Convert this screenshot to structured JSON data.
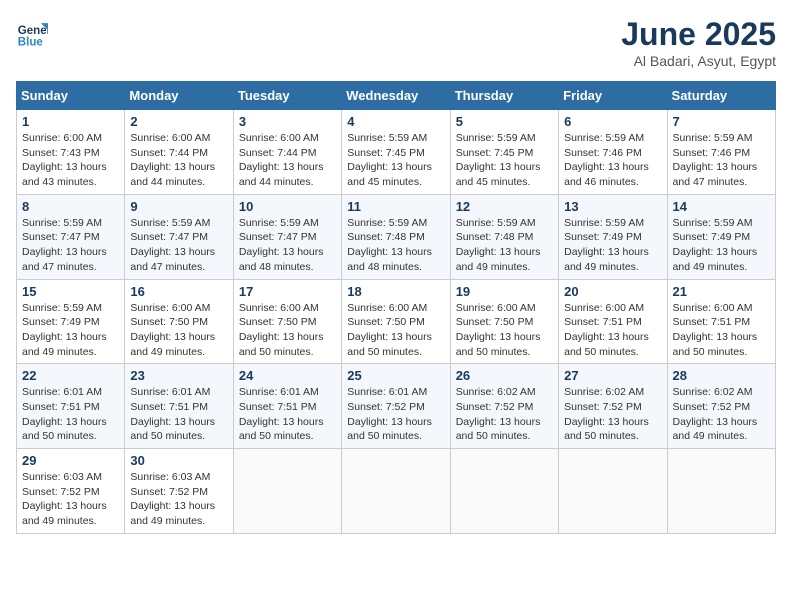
{
  "header": {
    "logo_line1": "General",
    "logo_line2": "Blue",
    "month_title": "June 2025",
    "location": "Al Badari, Asyut, Egypt"
  },
  "weekdays": [
    "Sunday",
    "Monday",
    "Tuesday",
    "Wednesday",
    "Thursday",
    "Friday",
    "Saturday"
  ],
  "weeks": [
    [
      {
        "day": "1",
        "sunrise": "6:00 AM",
        "sunset": "7:43 PM",
        "daylight": "13 hours and 43 minutes."
      },
      {
        "day": "2",
        "sunrise": "6:00 AM",
        "sunset": "7:44 PM",
        "daylight": "13 hours and 44 minutes."
      },
      {
        "day": "3",
        "sunrise": "6:00 AM",
        "sunset": "7:44 PM",
        "daylight": "13 hours and 44 minutes."
      },
      {
        "day": "4",
        "sunrise": "5:59 AM",
        "sunset": "7:45 PM",
        "daylight": "13 hours and 45 minutes."
      },
      {
        "day": "5",
        "sunrise": "5:59 AM",
        "sunset": "7:45 PM",
        "daylight": "13 hours and 45 minutes."
      },
      {
        "day": "6",
        "sunrise": "5:59 AM",
        "sunset": "7:46 PM",
        "daylight": "13 hours and 46 minutes."
      },
      {
        "day": "7",
        "sunrise": "5:59 AM",
        "sunset": "7:46 PM",
        "daylight": "13 hours and 47 minutes."
      }
    ],
    [
      {
        "day": "8",
        "sunrise": "5:59 AM",
        "sunset": "7:47 PM",
        "daylight": "13 hours and 47 minutes."
      },
      {
        "day": "9",
        "sunrise": "5:59 AM",
        "sunset": "7:47 PM",
        "daylight": "13 hours and 47 minutes."
      },
      {
        "day": "10",
        "sunrise": "5:59 AM",
        "sunset": "7:47 PM",
        "daylight": "13 hours and 48 minutes."
      },
      {
        "day": "11",
        "sunrise": "5:59 AM",
        "sunset": "7:48 PM",
        "daylight": "13 hours and 48 minutes."
      },
      {
        "day": "12",
        "sunrise": "5:59 AM",
        "sunset": "7:48 PM",
        "daylight": "13 hours and 49 minutes."
      },
      {
        "day": "13",
        "sunrise": "5:59 AM",
        "sunset": "7:49 PM",
        "daylight": "13 hours and 49 minutes."
      },
      {
        "day": "14",
        "sunrise": "5:59 AM",
        "sunset": "7:49 PM",
        "daylight": "13 hours and 49 minutes."
      }
    ],
    [
      {
        "day": "15",
        "sunrise": "5:59 AM",
        "sunset": "7:49 PM",
        "daylight": "13 hours and 49 minutes."
      },
      {
        "day": "16",
        "sunrise": "6:00 AM",
        "sunset": "7:50 PM",
        "daylight": "13 hours and 49 minutes."
      },
      {
        "day": "17",
        "sunrise": "6:00 AM",
        "sunset": "7:50 PM",
        "daylight": "13 hours and 50 minutes."
      },
      {
        "day": "18",
        "sunrise": "6:00 AM",
        "sunset": "7:50 PM",
        "daylight": "13 hours and 50 minutes."
      },
      {
        "day": "19",
        "sunrise": "6:00 AM",
        "sunset": "7:50 PM",
        "daylight": "13 hours and 50 minutes."
      },
      {
        "day": "20",
        "sunrise": "6:00 AM",
        "sunset": "7:51 PM",
        "daylight": "13 hours and 50 minutes."
      },
      {
        "day": "21",
        "sunrise": "6:00 AM",
        "sunset": "7:51 PM",
        "daylight": "13 hours and 50 minutes."
      }
    ],
    [
      {
        "day": "22",
        "sunrise": "6:01 AM",
        "sunset": "7:51 PM",
        "daylight": "13 hours and 50 minutes."
      },
      {
        "day": "23",
        "sunrise": "6:01 AM",
        "sunset": "7:51 PM",
        "daylight": "13 hours and 50 minutes."
      },
      {
        "day": "24",
        "sunrise": "6:01 AM",
        "sunset": "7:51 PM",
        "daylight": "13 hours and 50 minutes."
      },
      {
        "day": "25",
        "sunrise": "6:01 AM",
        "sunset": "7:52 PM",
        "daylight": "13 hours and 50 minutes."
      },
      {
        "day": "26",
        "sunrise": "6:02 AM",
        "sunset": "7:52 PM",
        "daylight": "13 hours and 50 minutes."
      },
      {
        "day": "27",
        "sunrise": "6:02 AM",
        "sunset": "7:52 PM",
        "daylight": "13 hours and 50 minutes."
      },
      {
        "day": "28",
        "sunrise": "6:02 AM",
        "sunset": "7:52 PM",
        "daylight": "13 hours and 49 minutes."
      }
    ],
    [
      {
        "day": "29",
        "sunrise": "6:03 AM",
        "sunset": "7:52 PM",
        "daylight": "13 hours and 49 minutes."
      },
      {
        "day": "30",
        "sunrise": "6:03 AM",
        "sunset": "7:52 PM",
        "daylight": "13 hours and 49 minutes."
      },
      null,
      null,
      null,
      null,
      null
    ]
  ]
}
